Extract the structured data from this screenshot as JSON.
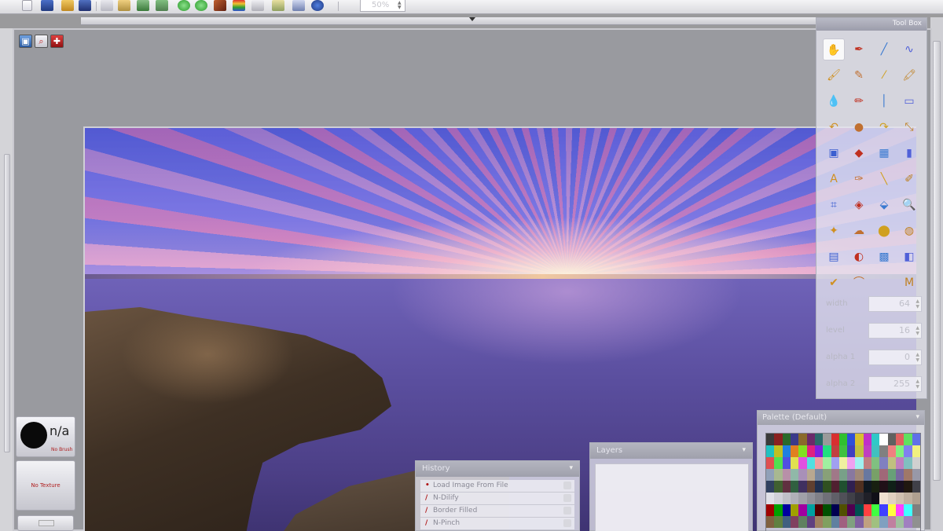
{
  "toolbar": {
    "zoom_value": "50%",
    "buttons": [
      "new-icon",
      "save-icon",
      "open-icon",
      "save-as-icon",
      "copy-icon",
      "paste-icon",
      "cut-icon",
      "image-icon",
      "filter-icon",
      "undo-icon",
      "redo-icon",
      "brush-options-icon",
      "colors-icon",
      "layers-icon",
      "history-icon",
      "document-icon",
      "help-icon"
    ]
  },
  "toolbox": {
    "title": "Tool Box",
    "params": [
      {
        "label": "width",
        "value": "64"
      },
      {
        "label": "level",
        "value": "16"
      },
      {
        "label": "alpha 1",
        "value": "0"
      },
      {
        "label": "alpha 2",
        "value": "255"
      }
    ],
    "tools": [
      "✋",
      "✒",
      "╱",
      "∿",
      "🖌",
      "✎",
      "⁄",
      "🖍",
      "💧",
      "✏",
      "│",
      "▭",
      "↶",
      "●",
      "↷",
      "⤡",
      "▣",
      "◆",
      "▦",
      "▮",
      "A",
      "✑",
      "╲",
      "✐",
      "⌗",
      "◈",
      "⬙",
      "🔍",
      "✦",
      "☁",
      "⬤",
      "◍",
      "▤",
      "◐",
      "▩",
      "◧",
      "✔",
      "⌒",
      "",
      "M"
    ],
    "accent": "#3b5fd0"
  },
  "palette": {
    "title": "Palette (Default)",
    "rows": [
      [
        "#3a3a3a",
        "#8a2020",
        "#2a6a2a",
        "#3a3a8a",
        "#8a6a2a",
        "#6a2a6a",
        "#2a6a6a",
        "#9a9a9a",
        "#d83030",
        "#30c030",
        "#3050d8",
        "#d8c030",
        "#c030c8",
        "#30c8c8",
        "#ffffff",
        "#606060",
        "#e06060",
        "#60e060",
        "#6070e8"
      ],
      [
        "#20c0c0",
        "#c0c020",
        "#2080e0",
        "#e08020",
        "#80e020",
        "#e02080",
        "#8020e0",
        "#20e080",
        "#c04040",
        "#40c040",
        "#4040c0",
        "#c0c040",
        "#c040c0",
        "#40c0c0",
        "#808080",
        "#f08080",
        "#80f080",
        "#8080f0",
        "#f0f080"
      ],
      [
        "#e05050",
        "#50e050",
        "#5050e0",
        "#e0e050",
        "#e050e0",
        "#50e0e0",
        "#f0a0a0",
        "#a0f0a0",
        "#a0a0f0",
        "#f0f0a0",
        "#f0a0f0",
        "#a0f0f0",
        "#c08080",
        "#80c080",
        "#8080c0",
        "#c0c080",
        "#c080c0",
        "#80c0c0",
        "#d0d0d0"
      ],
      [
        "#90a0b8",
        "#a8b890",
        "#b890a8",
        "#90b8a8",
        "#a890b8",
        "#b8a890",
        "#7888a0",
        "#88a078",
        "#a07888",
        "#78a088",
        "#8878a0",
        "#a08878",
        "#6878a0",
        "#78a068",
        "#a06878",
        "#68a078",
        "#7868a0",
        "#a07868",
        "#9898a8"
      ],
      [
        "#304060",
        "#406030",
        "#603040",
        "#306040",
        "#403060",
        "#604030",
        "#203050",
        "#305020",
        "#502030",
        "#205030",
        "#302050",
        "#503020",
        "#101820",
        "#182010",
        "#201018",
        "#102018",
        "#181020",
        "#201810",
        "#404048"
      ],
      [
        "#e0e0e8",
        "#d0d0d8",
        "#c0c0c8",
        "#b0b0b8",
        "#a0a0a8",
        "#909098",
        "#808088",
        "#707078",
        "#606068",
        "#505058",
        "#404048",
        "#303038",
        "#202028",
        "#101018",
        "#f0e0d0",
        "#e0d0c0",
        "#d0c0b0",
        "#c0b0a0",
        "#b0a090"
      ],
      [
        "#a00000",
        "#00a000",
        "#0000a0",
        "#a0a000",
        "#a000a0",
        "#00a0a0",
        "#500000",
        "#005000",
        "#000050",
        "#505000",
        "#500050",
        "#005050",
        "#ff4040",
        "#40ff40",
        "#4040ff",
        "#ffff40",
        "#ff40ff",
        "#40ffff",
        "#7f7f7f"
      ],
      [
        "#806040",
        "#608040",
        "#406080",
        "#804060",
        "#608060",
        "#604080",
        "#a08060",
        "#80a060",
        "#6080a0",
        "#a06080",
        "#80a080",
        "#8060a0",
        "#c0a080",
        "#a0c080",
        "#80a0c0",
        "#c080a0",
        "#a0c0a0",
        "#a080c0",
        "#909090"
      ]
    ]
  },
  "history": {
    "title": "History",
    "items": [
      {
        "label": "Load Image From File"
      },
      {
        "label": "N-Dilify"
      },
      {
        "label": "Border Filled"
      },
      {
        "label": "N-Pinch"
      }
    ]
  },
  "layers": {
    "title": "Layers"
  },
  "brush": {
    "size_text": "n/a",
    "brush_label": "No Brush",
    "texture_label": "No Texture"
  }
}
